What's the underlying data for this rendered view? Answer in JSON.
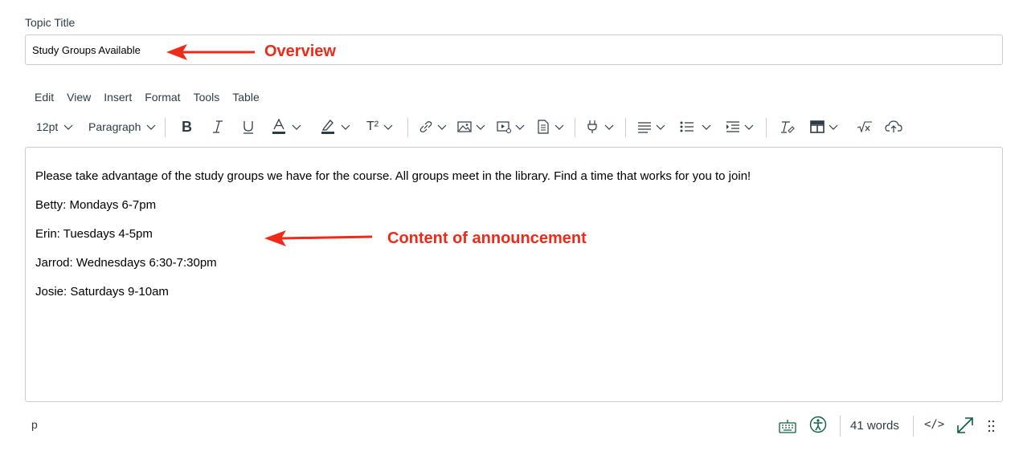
{
  "topic": {
    "label": "Topic Title",
    "value": "Study Groups Available"
  },
  "menubar": [
    "Edit",
    "View",
    "Insert",
    "Format",
    "Tools",
    "Table"
  ],
  "toolbar": {
    "font_size": "12pt",
    "block_format": "Paragraph",
    "superscript_label": "T²",
    "icons": [
      "bold-icon",
      "italic-icon",
      "underline-icon",
      "text-color-icon",
      "highlight-icon",
      "superscript-icon",
      "link-icon",
      "image-icon",
      "media-icon",
      "document-icon",
      "lti-apps-icon",
      "align-icon",
      "bullet-list-icon",
      "indent-icon",
      "clear-formatting-icon",
      "table-icon",
      "math-equation-icon",
      "upload-cloud-icon"
    ]
  },
  "content": {
    "paragraphs": [
      "Please take advantage of the study groups we have for the course. All groups meet in the library. Find a time that works for you to join!",
      "Betty: Mondays 6-7pm",
      "Erin: Tuesdays 4-5pm",
      "Jarrod: Wednesdays 6:30-7:30pm",
      "Josie: Saturdays 9-10am"
    ]
  },
  "statusbar": {
    "element_path": "p",
    "word_count": "41 words",
    "html_editor_label": "</>"
  },
  "annotations": {
    "overview": "Overview",
    "content": "Content of announcement",
    "color": "#ee2a18"
  },
  "colors": {
    "accent_green": "#0b5f3a",
    "border": "#c7cdd1"
  }
}
